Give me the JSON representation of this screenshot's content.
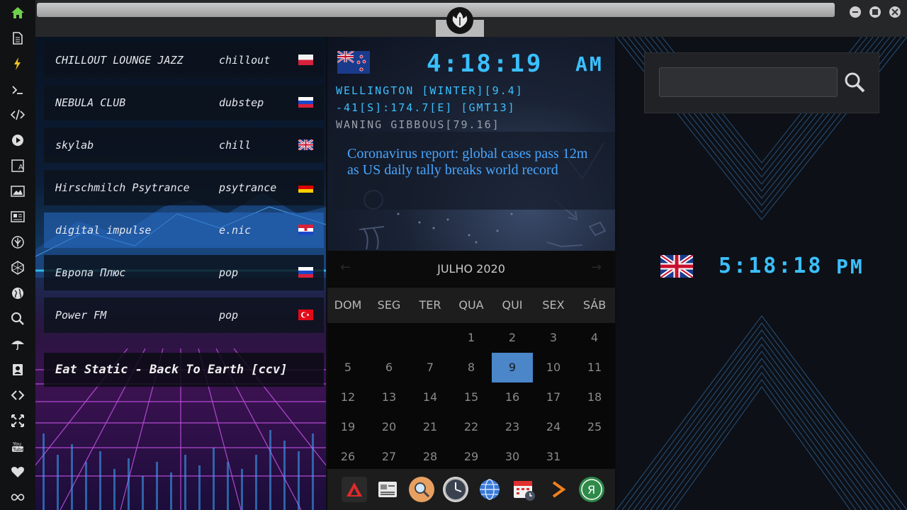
{
  "colors": {
    "accent": "#3ac0ff",
    "selected_day": "#4a86c8",
    "news_text": "#49a6ff"
  },
  "sidebar": {
    "icons": [
      "home-icon",
      "document-icon",
      "bolt-icon",
      "terminal-icon",
      "code-icon",
      "play-icon",
      "translate-icon",
      "image-icon",
      "news-icon",
      "rebel-icon",
      "hexagon-icon",
      "globe-icon",
      "search-icon",
      "umbrella-icon",
      "contact-icon",
      "link-icon",
      "expand-icon",
      "youtube-icon",
      "heart-icon",
      "infinity-icon"
    ],
    "youtube_label": "You Tube"
  },
  "radio": {
    "stations": [
      {
        "name": "CHILLOUT LOUNGE JAZZ",
        "genre": "chillout",
        "flag": "poland"
      },
      {
        "name": "NEBULA CLUB",
        "genre": "dubstep",
        "flag": "russia"
      },
      {
        "name": "skylab",
        "genre": "chill",
        "flag": "uk"
      },
      {
        "name": "Hirschmilch Psytrance",
        "genre": "psytrance",
        "flag": "germany"
      },
      {
        "name": "digital impulse",
        "genre": "e.nic",
        "flag": "croatia"
      },
      {
        "name": "Европа Плюс",
        "genre": "pop",
        "flag": "russia"
      },
      {
        "name": "Power FM",
        "genre": "pop",
        "flag": "turkey"
      }
    ],
    "now_playing": "Eat Static - Back To Earth [ccv]"
  },
  "clock_local": {
    "time": "4:18:19",
    "ampm": "AM",
    "line1": "WELLINGTON [WINTER][9.4]",
    "line2": "-41[S]:174.7[E] [GMT13]",
    "line3": "WANING GIBBOUS[79.16]",
    "flag": "new-zealand"
  },
  "news": {
    "headline": "Coronavirus report: global cases pass 12m as US daily tally breaks world record"
  },
  "calendar": {
    "month": "JULHO 2020",
    "days": [
      "DOM",
      "SEG",
      "TER",
      "QUA",
      "QUI",
      "SEX",
      "SÁB"
    ],
    "weeks": [
      [
        "",
        "",
        "",
        "1",
        "2",
        "3",
        "4"
      ],
      [
        "5",
        "6",
        "7",
        "8",
        "9",
        "10",
        "11"
      ],
      [
        "12",
        "13",
        "14",
        "15",
        "16",
        "17",
        "18"
      ],
      [
        "19",
        "20",
        "21",
        "22",
        "23",
        "24",
        "25"
      ],
      [
        "26",
        "27",
        "28",
        "29",
        "30",
        "31",
        ""
      ]
    ],
    "selected": "9"
  },
  "dock": {
    "icons": [
      "app-a-icon",
      "news-app-icon",
      "search-app-icon",
      "clock-app-icon",
      "globe-app-icon",
      "calendar-app-icon",
      "arrow-app-icon",
      "yandex-icon"
    ]
  },
  "clock_remote": {
    "time": "5:18:18",
    "ampm": "PM",
    "flag": "uk"
  },
  "search": {
    "placeholder": ""
  }
}
